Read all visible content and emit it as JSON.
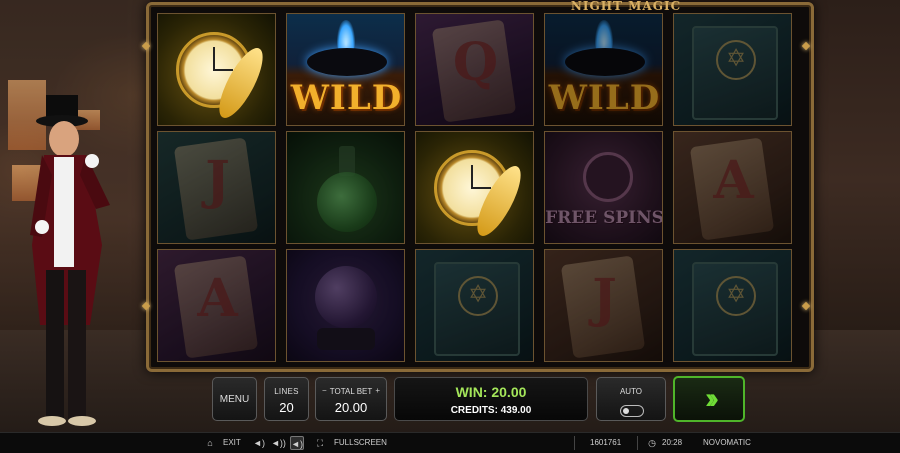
{
  "game": {
    "title": "NIGHT MAGIC"
  },
  "reels": [
    {
      "symbols": [
        {
          "type": "clock",
          "label": ""
        },
        {
          "type": "card",
          "label": "J"
        },
        {
          "type": "card",
          "label": "A"
        }
      ]
    },
    {
      "symbols": [
        {
          "type": "wild",
          "label": "WILD"
        },
        {
          "type": "potion",
          "label": ""
        },
        {
          "type": "orb",
          "label": ""
        }
      ]
    },
    {
      "symbols": [
        {
          "type": "card",
          "label": "Q"
        },
        {
          "type": "clock",
          "label": ""
        },
        {
          "type": "book",
          "label": ""
        }
      ]
    },
    {
      "symbols": [
        {
          "type": "wild",
          "label": "WILD"
        },
        {
          "type": "free_spins",
          "label": "FREE SPINS"
        },
        {
          "type": "card",
          "label": "J"
        }
      ]
    },
    {
      "symbols": [
        {
          "type": "book",
          "label": ""
        },
        {
          "type": "card",
          "label": "A"
        },
        {
          "type": "book",
          "label": ""
        }
      ]
    }
  ],
  "controls": {
    "menu_label": "MENU",
    "lines_label": "LINES",
    "lines_value": "20",
    "total_bet_label": "TOTAL BET",
    "total_bet_value": "20.00",
    "bet_decrease_icon": "minus-icon",
    "bet_increase_icon": "plus-icon",
    "win_text": "WIN: 20.00",
    "credits_text": "CREDITS: 439.00",
    "auto_label": "AUTO",
    "auto_enabled": false,
    "spin_icon": "double-chevron-right-icon"
  },
  "status_bar": {
    "exit_label": "EXIT",
    "fullscreen_label": "FULLSCREEN",
    "session_id": "1601761",
    "time": "20:28",
    "brand": "NOVOMATIC"
  },
  "colors": {
    "frame_gold": "#8a6a38",
    "win_green": "#a4e65a",
    "spin_green": "#4fb52a"
  }
}
